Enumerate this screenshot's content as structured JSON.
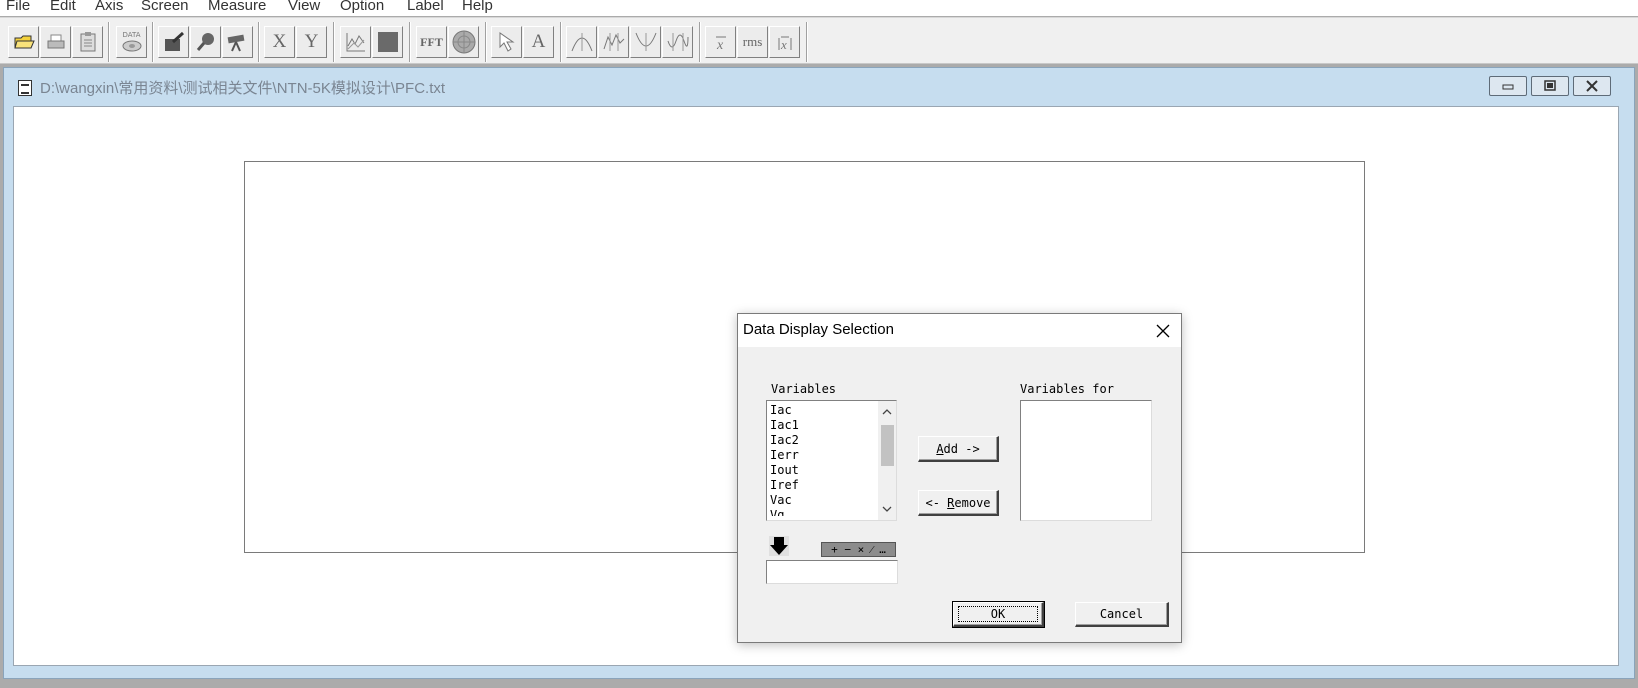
{
  "menu": {
    "items": [
      {
        "label": "File"
      },
      {
        "label": "Edit"
      },
      {
        "label": "Axis"
      },
      {
        "label": "Screen"
      },
      {
        "label": "Measure"
      },
      {
        "label": "View"
      },
      {
        "label": "Option"
      },
      {
        "label": "Label"
      },
      {
        "label": "Help"
      }
    ]
  },
  "toolbar": {
    "data_label": "DATA",
    "x_label": "X",
    "y_label": "Y",
    "fft_label": "FFT",
    "text_label": "A",
    "rms_label": "rms"
  },
  "window": {
    "title": "D:\\wangxin\\常用资料\\测试相关文件\\NTN-5K模拟设计\\PFC.txt"
  },
  "dialog": {
    "title": "Data Display Selection",
    "variables_label": "Variables",
    "variables_for_label": "Variables for",
    "variables": [
      "Iac",
      "Iac1",
      "Iac2",
      "Ierr",
      "Iout",
      "Iref",
      "Vac",
      "Vg"
    ],
    "add_button": {
      "prefix": "",
      "mnemonic": "A",
      "rest": "dd ->"
    },
    "remove_button": {
      "prefix": "<- ",
      "mnemonic": "R",
      "rest": "emove"
    },
    "operators": "+ − × ⁄ …",
    "expression_value": "",
    "ok_label": "OK",
    "cancel_label": "Cancel"
  }
}
